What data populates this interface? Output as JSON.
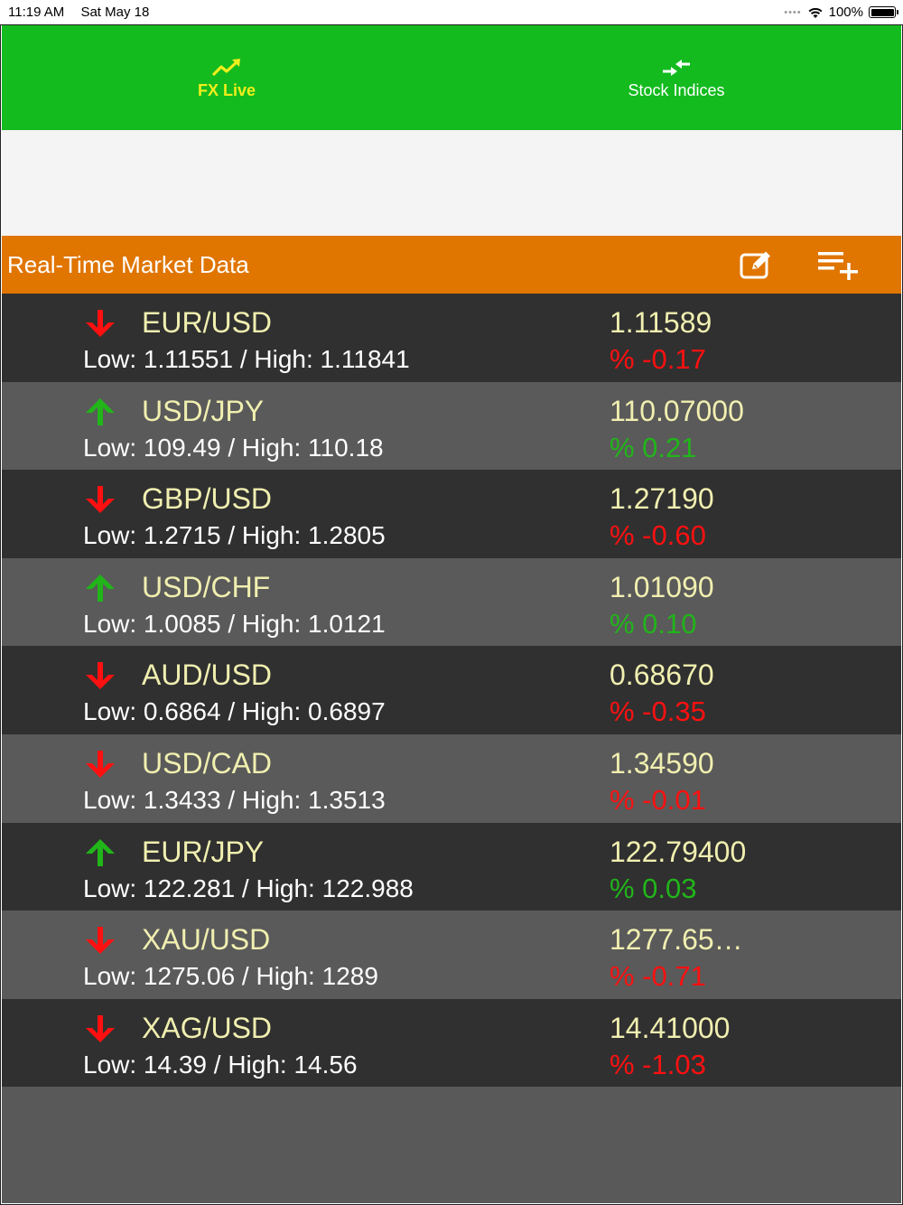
{
  "status_bar": {
    "time": "11:19 AM",
    "date": "Sat May 18",
    "signal_dots": "••••",
    "battery_percent": "100%",
    "battery_level": 1.0
  },
  "tabs": [
    {
      "label": "FX Live",
      "icon": "trending-up-icon",
      "active": true
    },
    {
      "label": "Stock Indices",
      "icon": "swap-arrows-icon",
      "active": false
    }
  ],
  "header": {
    "title": "Real-Time Market Data",
    "edit_icon": "edit-icon",
    "add_icon": "playlist-add-icon"
  },
  "colors": {
    "tabbar": "#13bb1f",
    "active_tab": "#f0ee1c",
    "header": "#e07500",
    "down": "#ff1010",
    "up": "#21b51a",
    "pair_text": "#f0efb0"
  },
  "rates": [
    {
      "pair": "EUR/USD",
      "range": "Low: 1.11551 / High: 1.11841",
      "price": "1.11589",
      "change": "% -0.17",
      "direction": "down"
    },
    {
      "pair": "USD/JPY",
      "range": "Low: 109.49 / High: 110.18",
      "price": "110.07000",
      "change": "% 0.21",
      "direction": "up"
    },
    {
      "pair": "GBP/USD",
      "range": "Low: 1.2715 / High: 1.2805",
      "price": "1.27190",
      "change": "% -0.60",
      "direction": "down"
    },
    {
      "pair": "USD/CHF",
      "range": "Low: 1.0085 / High: 1.0121",
      "price": "1.01090",
      "change": "% 0.10",
      "direction": "up"
    },
    {
      "pair": "AUD/USD",
      "range": "Low: 0.6864 / High: 0.6897",
      "price": "0.68670",
      "change": "% -0.35",
      "direction": "down"
    },
    {
      "pair": "USD/CAD",
      "range": "Low: 1.3433 / High: 1.3513",
      "price": "1.34590",
      "change": "% -0.01",
      "direction": "down"
    },
    {
      "pair": "EUR/JPY",
      "range": "Low: 122.281 / High: 122.988",
      "price": "122.79400",
      "change": "% 0.03",
      "direction": "up"
    },
    {
      "pair": "XAU/USD",
      "range": "Low: 1275.06 / High: 1289",
      "price": "1277.65…",
      "change": "% -0.71",
      "direction": "down"
    },
    {
      "pair": "XAG/USD",
      "range": "Low: 14.39 / High: 14.56",
      "price": "14.41000",
      "change": "% -1.03",
      "direction": "down"
    }
  ]
}
